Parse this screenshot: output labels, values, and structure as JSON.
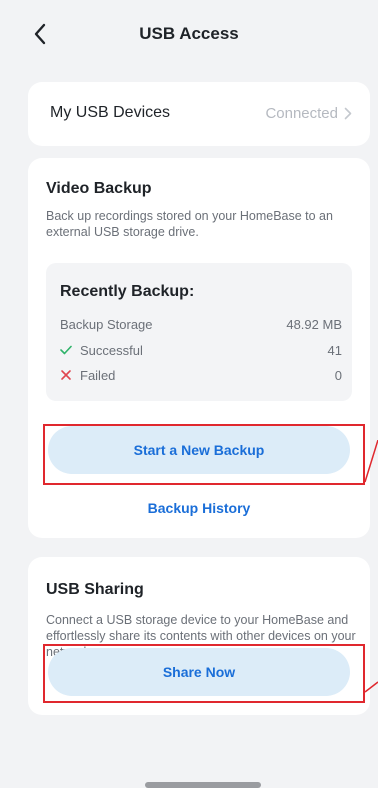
{
  "header": {
    "title": "USB Access",
    "back_icon": "chevron-left-icon"
  },
  "devices": {
    "label": "My USB Devices",
    "status": "Connected"
  },
  "video_backup": {
    "title": "Video Backup",
    "description": "Back up recordings stored on your HomeBase to an external USB storage drive.",
    "recent": {
      "title": "Recently Backup:",
      "storage_label": "Backup Storage",
      "storage_value": "48.92 MB",
      "success_label": "Successful",
      "success_value": "41",
      "failed_label": "Failed",
      "failed_value": "0"
    },
    "start_button": "Start a New Backup",
    "history_link": "Backup History"
  },
  "usb_sharing": {
    "title": "USB Sharing",
    "description": "Connect a USB storage device to your HomeBase and effortlessly share its contents with other devices on your network.",
    "share_button": "Share Now"
  },
  "colors": {
    "accent": "#1a6ed8",
    "button_bg": "#dcecf8",
    "success": "#2fb36a",
    "failed": "#e0454f",
    "highlight": "#e0282e"
  }
}
